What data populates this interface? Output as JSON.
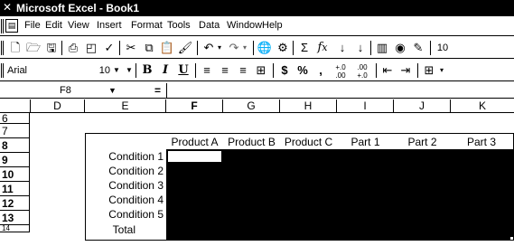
{
  "window": {
    "title": "Microsoft Excel - Book1"
  },
  "menu": [
    "File",
    "Edit",
    "View",
    "Insert",
    "Format",
    "Tools",
    "Data",
    "Window",
    "Help"
  ],
  "standard_toolbar": {
    "icons": [
      "new-icon",
      "open-icon",
      "save-icon",
      "print-icon",
      "print-preview-icon",
      "spelling-icon",
      "cut-icon",
      "copy-icon",
      "paste-icon",
      "format-painter-icon",
      "undo-icon",
      "redo-icon",
      "hyperlink-icon",
      "web-toolbar-icon",
      "autosum-icon",
      "function-icon",
      "sort-ascending-icon",
      "sort-descending-icon",
      "chart-wizard-icon",
      "map-icon",
      "drawing-icon"
    ],
    "zoom_partial": "10"
  },
  "formatting_toolbar": {
    "font": "Arial",
    "size": "10",
    "bold": "B",
    "italic": "I",
    "underline": "U",
    "currency": "$",
    "percent": "%",
    "comma": ",",
    "inc_decimal": "+.0 .00",
    "dec_decimal": ".00 +.0"
  },
  "formula_bar": {
    "name_box": "F8",
    "equals": "=",
    "value": ""
  },
  "columns": [
    "D",
    "E",
    "F",
    "G",
    "H",
    "I",
    "J",
    "K"
  ],
  "rows": [
    "6",
    "7",
    "8",
    "9",
    "10",
    "11",
    "12",
    "13",
    "14"
  ],
  "table": {
    "headers": [
      "Product A",
      "Product B",
      "Product C",
      "Part 1",
      "Part 2",
      "Part 3"
    ],
    "row_labels": [
      "Condition 1",
      "Condition 2",
      "Condition 3",
      "Condition 4",
      "Condition 5",
      "Total"
    ]
  },
  "colors": {
    "fill": "#000000",
    "background": "#ffffff"
  }
}
